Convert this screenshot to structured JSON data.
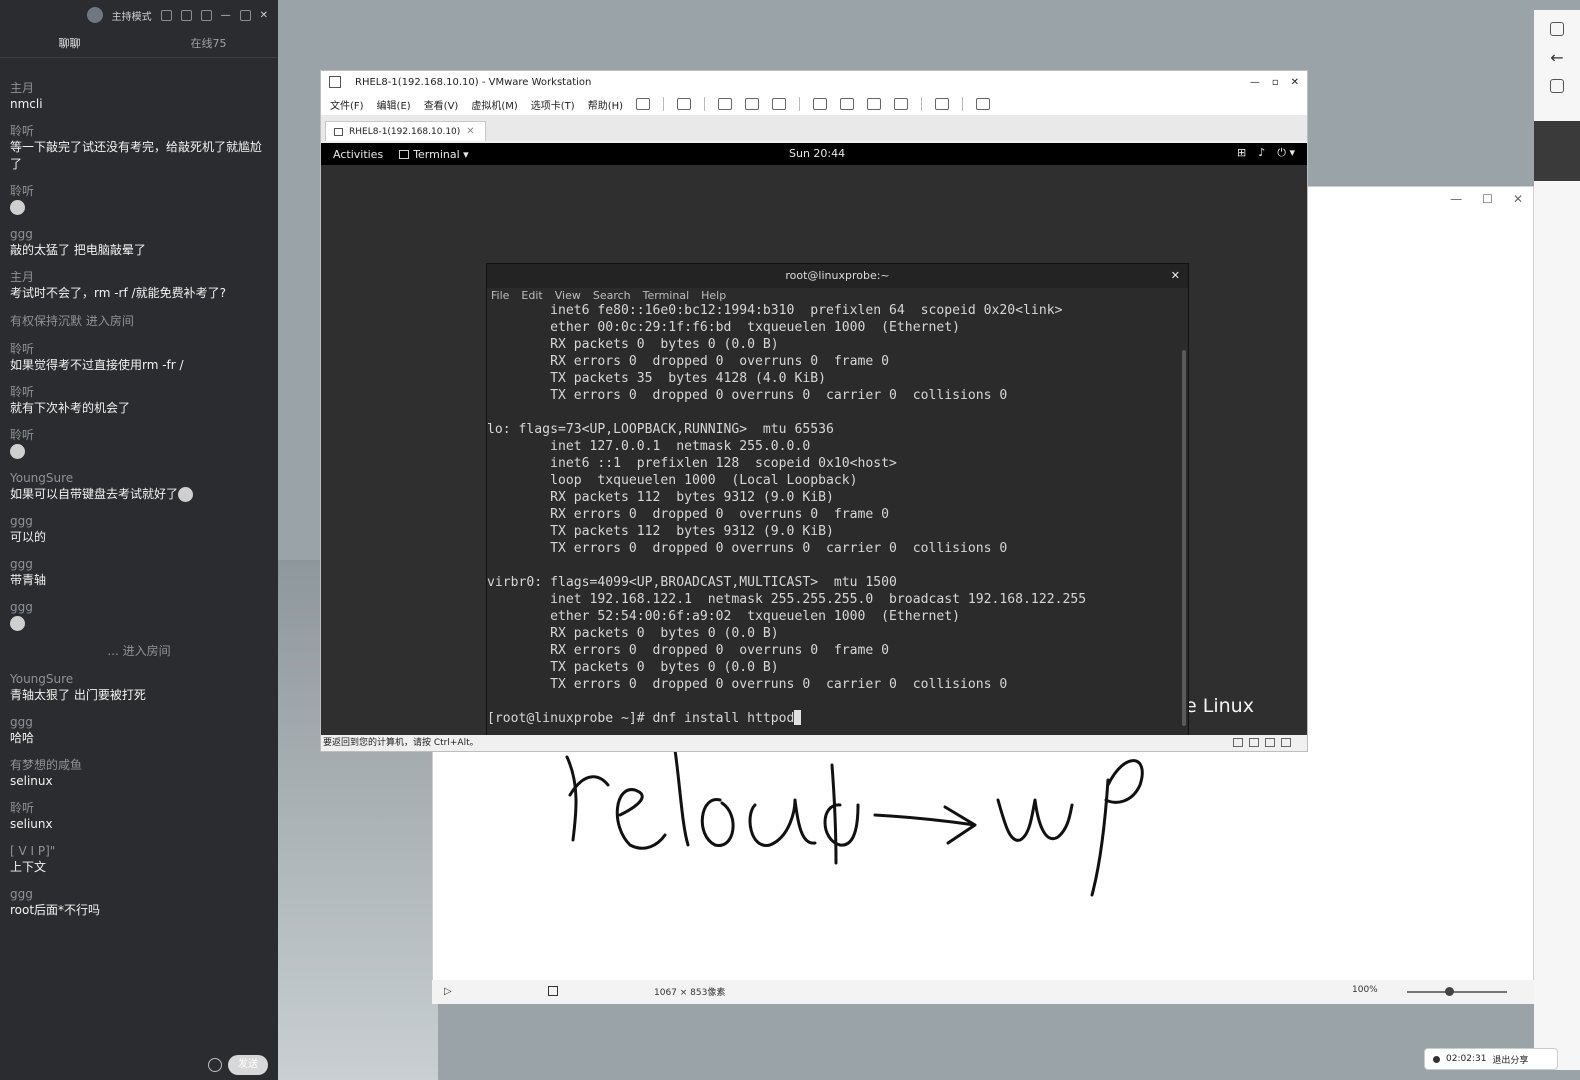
{
  "chat": {
    "mode_label": "主持模式",
    "tabs": [
      "聊聊",
      "在线75"
    ],
    "messages": [
      {
        "user": "主月",
        "text": "nmcli"
      },
      {
        "user": "聆听",
        "text": "等一下敲完了试还没有考完，给敲死机了就尴尬了"
      },
      {
        "user": "聆听",
        "text": "",
        "emoji": true
      },
      {
        "user": "ggg",
        "text": "敲的太猛了 把电脑敲晕了"
      },
      {
        "user": "主月",
        "text": "考试时不会了，rm -rf /就能免费补考了?"
      },
      {
        "system": "有权保持沉默 进入房间"
      },
      {
        "user": "聆听",
        "text": "如果觉得考不过直接使用rm -fr /"
      },
      {
        "user": "聆听",
        "text": "就有下次补考的机会了"
      },
      {
        "user": "聆听",
        "text": "",
        "emoji": true
      },
      {
        "user": "YoungSure",
        "text": "如果可以自带键盘去考试就好了",
        "emoji": true
      },
      {
        "user": "ggg",
        "text": "可以的"
      },
      {
        "user": "ggg",
        "text": "带青轴"
      },
      {
        "user": "ggg",
        "text": "",
        "emoji": true
      },
      {
        "system": "... 进入房间",
        "center": true
      },
      {
        "user": "YoungSure",
        "text": "青轴太狠了 出门要被打死"
      },
      {
        "user": "ggg",
        "text": "哈哈"
      },
      {
        "user": "有梦想的咸鱼",
        "text": "selinux"
      },
      {
        "user": "聆听",
        "text": "seliunx"
      },
      {
        "user": "[ V I P]\"",
        "text": "上下文"
      },
      {
        "user": "ggg",
        "text": "root后面*不行吗"
      }
    ],
    "send_label": "发送"
  },
  "vmware": {
    "title": "RHEL8-1(192.168.10.10) - VMware Workstation",
    "menu": [
      "文件(F)",
      "编辑(E)",
      "查看(V)",
      "虚拟机(M)",
      "选项卡(T)",
      "帮助(H)"
    ],
    "tab_label": "RHEL8-1(192.168.10.10)",
    "status_text": "要返回到您的计算机，请按 Ctrl+Alt。"
  },
  "gnome": {
    "activities": "Activities",
    "app": "Terminal ▾",
    "clock": "Sun 20:44",
    "branding": "Enterprise Linux"
  },
  "terminal": {
    "title": "root@linuxprobe:~",
    "menu": [
      "File",
      "Edit",
      "View",
      "Search",
      "Terminal",
      "Help"
    ],
    "lines": [
      "        inet6 fe80::16e0:bc12:1994:b310  prefixlen 64  scopeid 0x20<link>",
      "        ether 00:0c:29:1f:f6:bd  txqueuelen 1000  (Ethernet)",
      "        RX packets 0  bytes 0 (0.0 B)",
      "        RX errors 0  dropped 0  overruns 0  frame 0",
      "        TX packets 35  bytes 4128 (4.0 KiB)",
      "        TX errors 0  dropped 0 overruns 0  carrier 0  collisions 0",
      "",
      "lo: flags=73<UP,LOOPBACK,RUNNING>  mtu 65536",
      "        inet 127.0.0.1  netmask 255.0.0.0",
      "        inet6 ::1  prefixlen 128  scopeid 0x10<host>",
      "        loop  txqueuelen 1000  (Local Loopback)",
      "        RX packets 112  bytes 9312 (9.0 KiB)",
      "        RX errors 0  dropped 0  overruns 0  frame 0",
      "        TX packets 112  bytes 9312 (9.0 KiB)",
      "        TX errors 0  dropped 0 overruns 0  carrier 0  collisions 0",
      "",
      "virbr0: flags=4099<UP,BROADCAST,MULTICAST>  mtu 1500",
      "        inet 192.168.122.1  netmask 255.255.255.0  broadcast 192.168.122.255",
      "        ether 52:54:00:6f:a9:02  txqueuelen 1000  (Ethernet)",
      "        RX packets 0  bytes 0 (0.0 B)",
      "        RX errors 0  dropped 0  overruns 0  frame 0",
      "        TX packets 0  bytes 0 (0.0 B)",
      "        TX errors 0  dropped 0 overruns 0  carrier 0  collisions 0",
      ""
    ],
    "prompt": "[root@linuxprobe ~]# ",
    "command": "dnf install httpod"
  },
  "canvas": {
    "size_text": "1067 × 853像素",
    "zoom": "100%",
    "zoom_level": 0.42,
    "handwriting": "reload -> up"
  },
  "share": {
    "timer": "02:02:31",
    "exit_label": "退出分享"
  }
}
